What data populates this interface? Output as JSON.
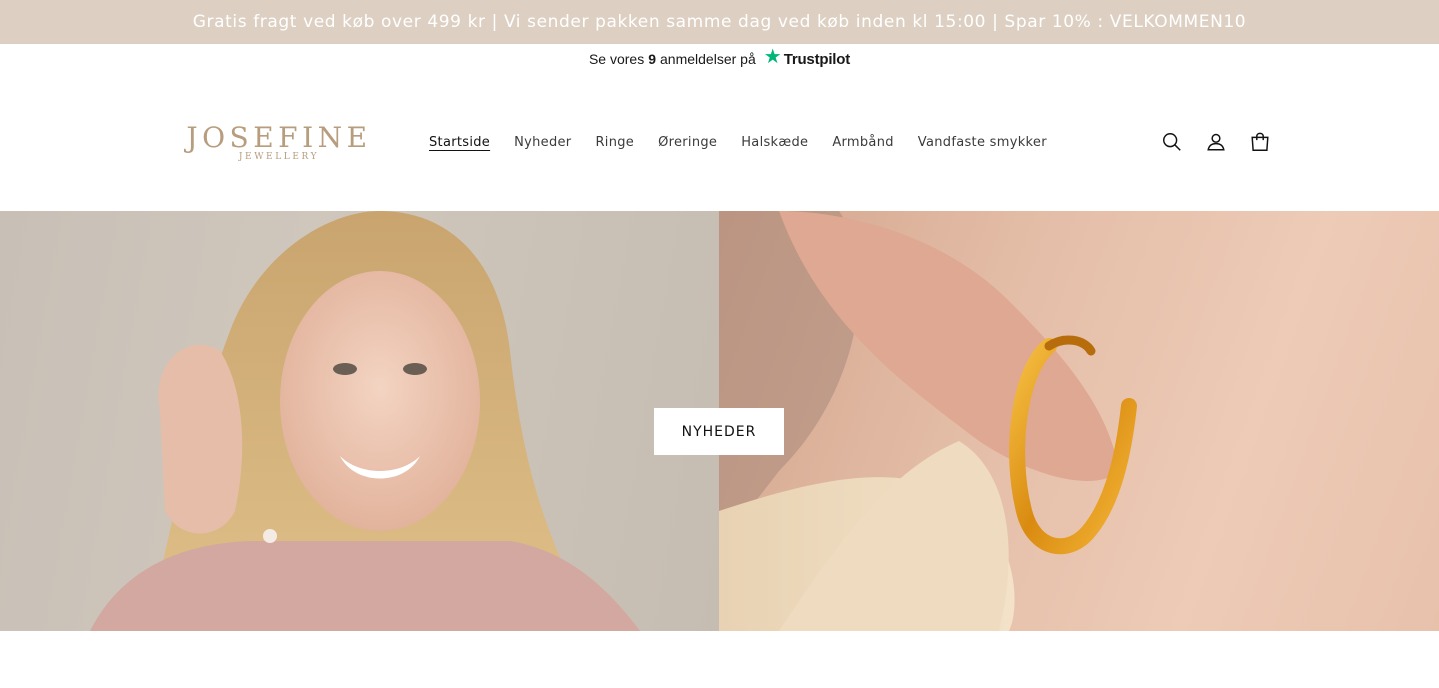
{
  "announcement": {
    "text": "Gratis fragt ved køb over 499 kr | Vi sender pakken samme dag ved køb inden kl 15:00 | Spar 10% : VELKOMMEN10"
  },
  "trustpilot": {
    "prefix": "Se vores",
    "count": "9",
    "suffix": "anmeldelser på",
    "brand": "Trustpilot",
    "star_color": "#00b67a"
  },
  "logo": {
    "main": "JOSEFINE",
    "sub": "JEWELLERY",
    "color": "#b79d7d"
  },
  "nav": {
    "items": [
      {
        "label": "Startside",
        "active": true
      },
      {
        "label": "Nyheder"
      },
      {
        "label": "Ringe"
      },
      {
        "label": "Øreringe"
      },
      {
        "label": "Halskæde"
      },
      {
        "label": "Armbånd"
      },
      {
        "label": "Vandfaste smykker"
      }
    ]
  },
  "header_icons": [
    "search-icon",
    "account-icon",
    "cart-icon"
  ],
  "hero": {
    "button_label": "NYHEDER"
  },
  "colors": {
    "announcement_bg": "#ddd0c3",
    "announcement_text": "#ffffff",
    "text": "#121212"
  }
}
